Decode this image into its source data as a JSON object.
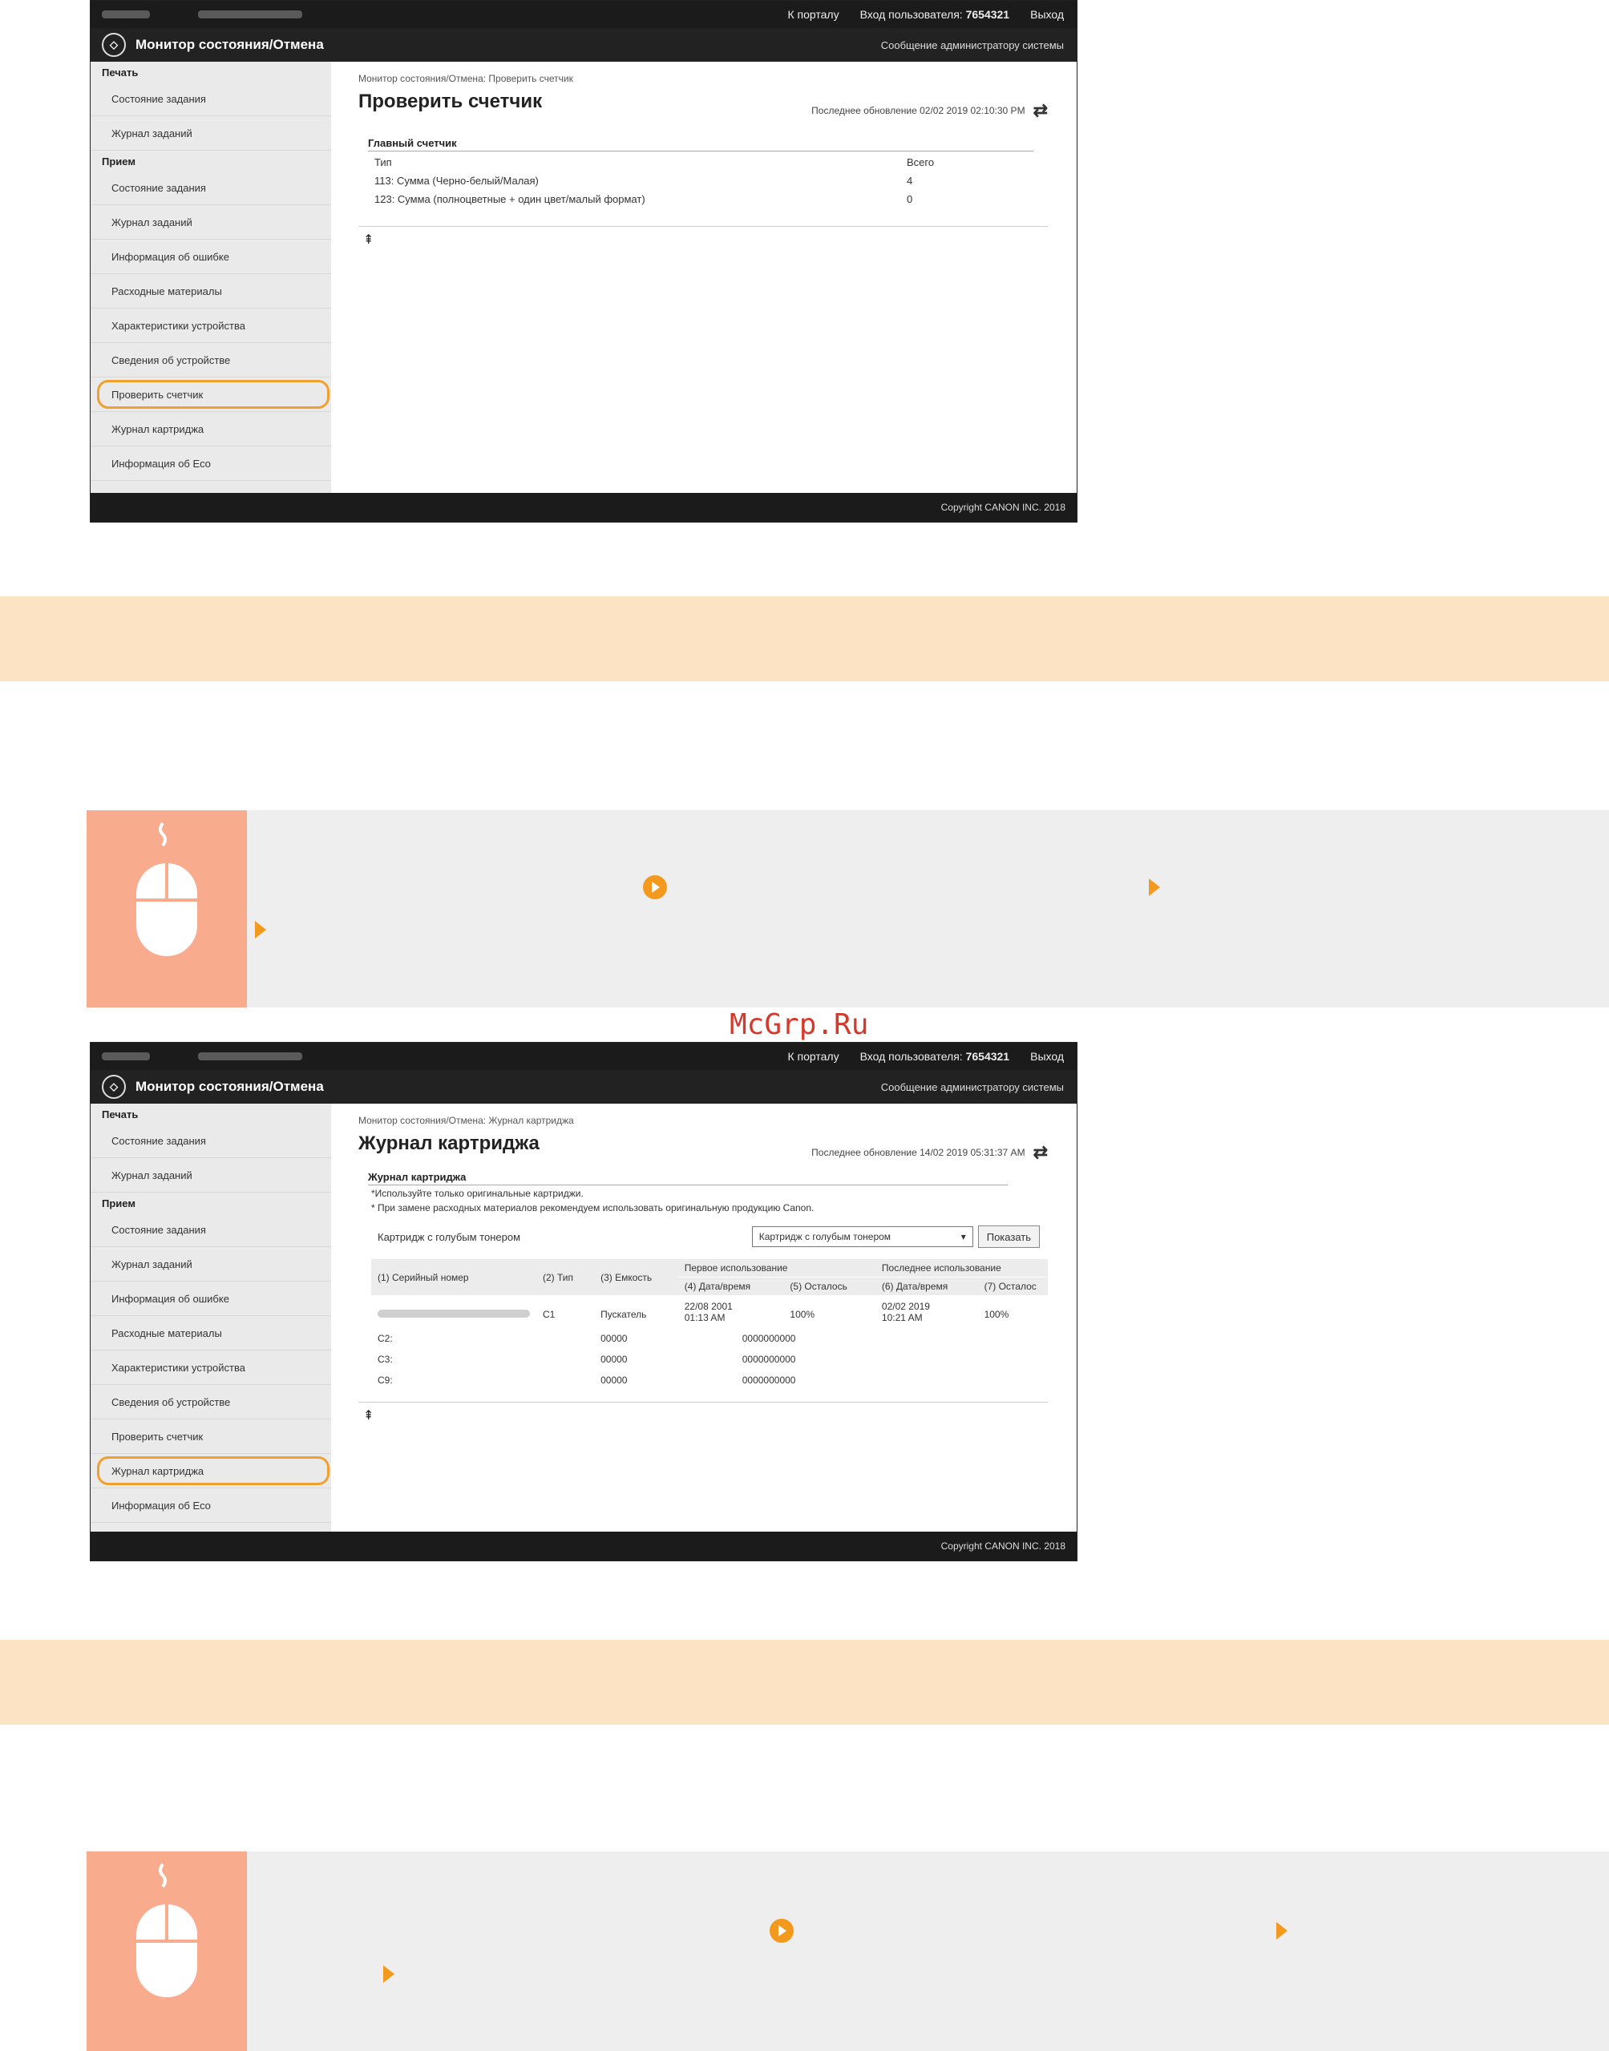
{
  "topbar": {
    "portal": "К порталу",
    "login_label": "Вход пользователя:",
    "user_id": "7654321",
    "logout": "Выход"
  },
  "titlebar": {
    "title": "Монитор состояния/Отмена",
    "admin_link": "Сообщение администратору системы"
  },
  "sidebar": {
    "print_head": "Печать",
    "print_items": [
      "Состояние задания",
      "Журнал заданий"
    ],
    "receive_head": "Прием",
    "receive_items": [
      "Состояние задания",
      "Журнал заданий",
      "Информация об ошибке",
      "Расходные материалы",
      "Характеристики устройства",
      "Сведения об устройстве",
      "Проверить счетчик",
      "Журнал картриджа",
      "Информация об Eco"
    ]
  },
  "page1": {
    "breadcrumb": "Монитор состояния/Отмена: Проверить счетчик",
    "title": "Проверить счетчик",
    "updated": "Последнее обновление 02/02 2019 02:10:30 PM",
    "section": "Главный счетчик",
    "col_type": "Тип",
    "col_total": "Всего",
    "rows": [
      {
        "type": "113: Сумма (Черно-белый/Малая)",
        "total": "4"
      },
      {
        "type": "123: Сумма (полноцветные + один цвет/малый формат)",
        "total": "0"
      }
    ]
  },
  "page2": {
    "breadcrumb": "Монитор состояния/Отмена: Журнал картриджа",
    "title": "Журнал картриджа",
    "updated": "Последнее обновление 14/02 2019 05:31:37 AM",
    "section": "Журнал картриджа",
    "note1": "*Используйте только оригинальные картриджи.",
    "note2": "* При замене расходных материалов рекомендуем использовать оригинальную продукцию Canon.",
    "select_label": "Картридж с голубым тонером",
    "select_value": "Картридж с голубым тонером",
    "show_button": "Показать",
    "group_first": "Первое использование",
    "group_last": "Последнее использование",
    "h1": "(1) Серийный номер",
    "h2": "(2) Тип",
    "h3": "(3) Емкость",
    "h4": "(4) Дата/время",
    "h5": "(5) Осталось",
    "h6": "(6) Дата/время",
    "h7": "(7) Осталос",
    "row1": {
      "type": "C1",
      "capacity": "Пускатель",
      "first_date": "22/08 2001",
      "first_time": "01:13 AM",
      "first_left": "100%",
      "last_date": "02/02 2019",
      "last_time": "10:21 AM",
      "last_left": "100%"
    },
    "rows_c": [
      {
        "type": "C2:",
        "capacity": "00000",
        "value": "0000000000"
      },
      {
        "type": "C3:",
        "capacity": "00000",
        "value": "0000000000"
      },
      {
        "type": "C9:",
        "capacity": "00000",
        "value": "0000000000"
      }
    ]
  },
  "footer": "Copyright CANON INC. 2018",
  "watermark": "McGrp.Ru",
  "colors": {
    "band": "#fbe3c4",
    "accent": "#f39a1e",
    "mouse_tile": "#f9ab8d"
  }
}
